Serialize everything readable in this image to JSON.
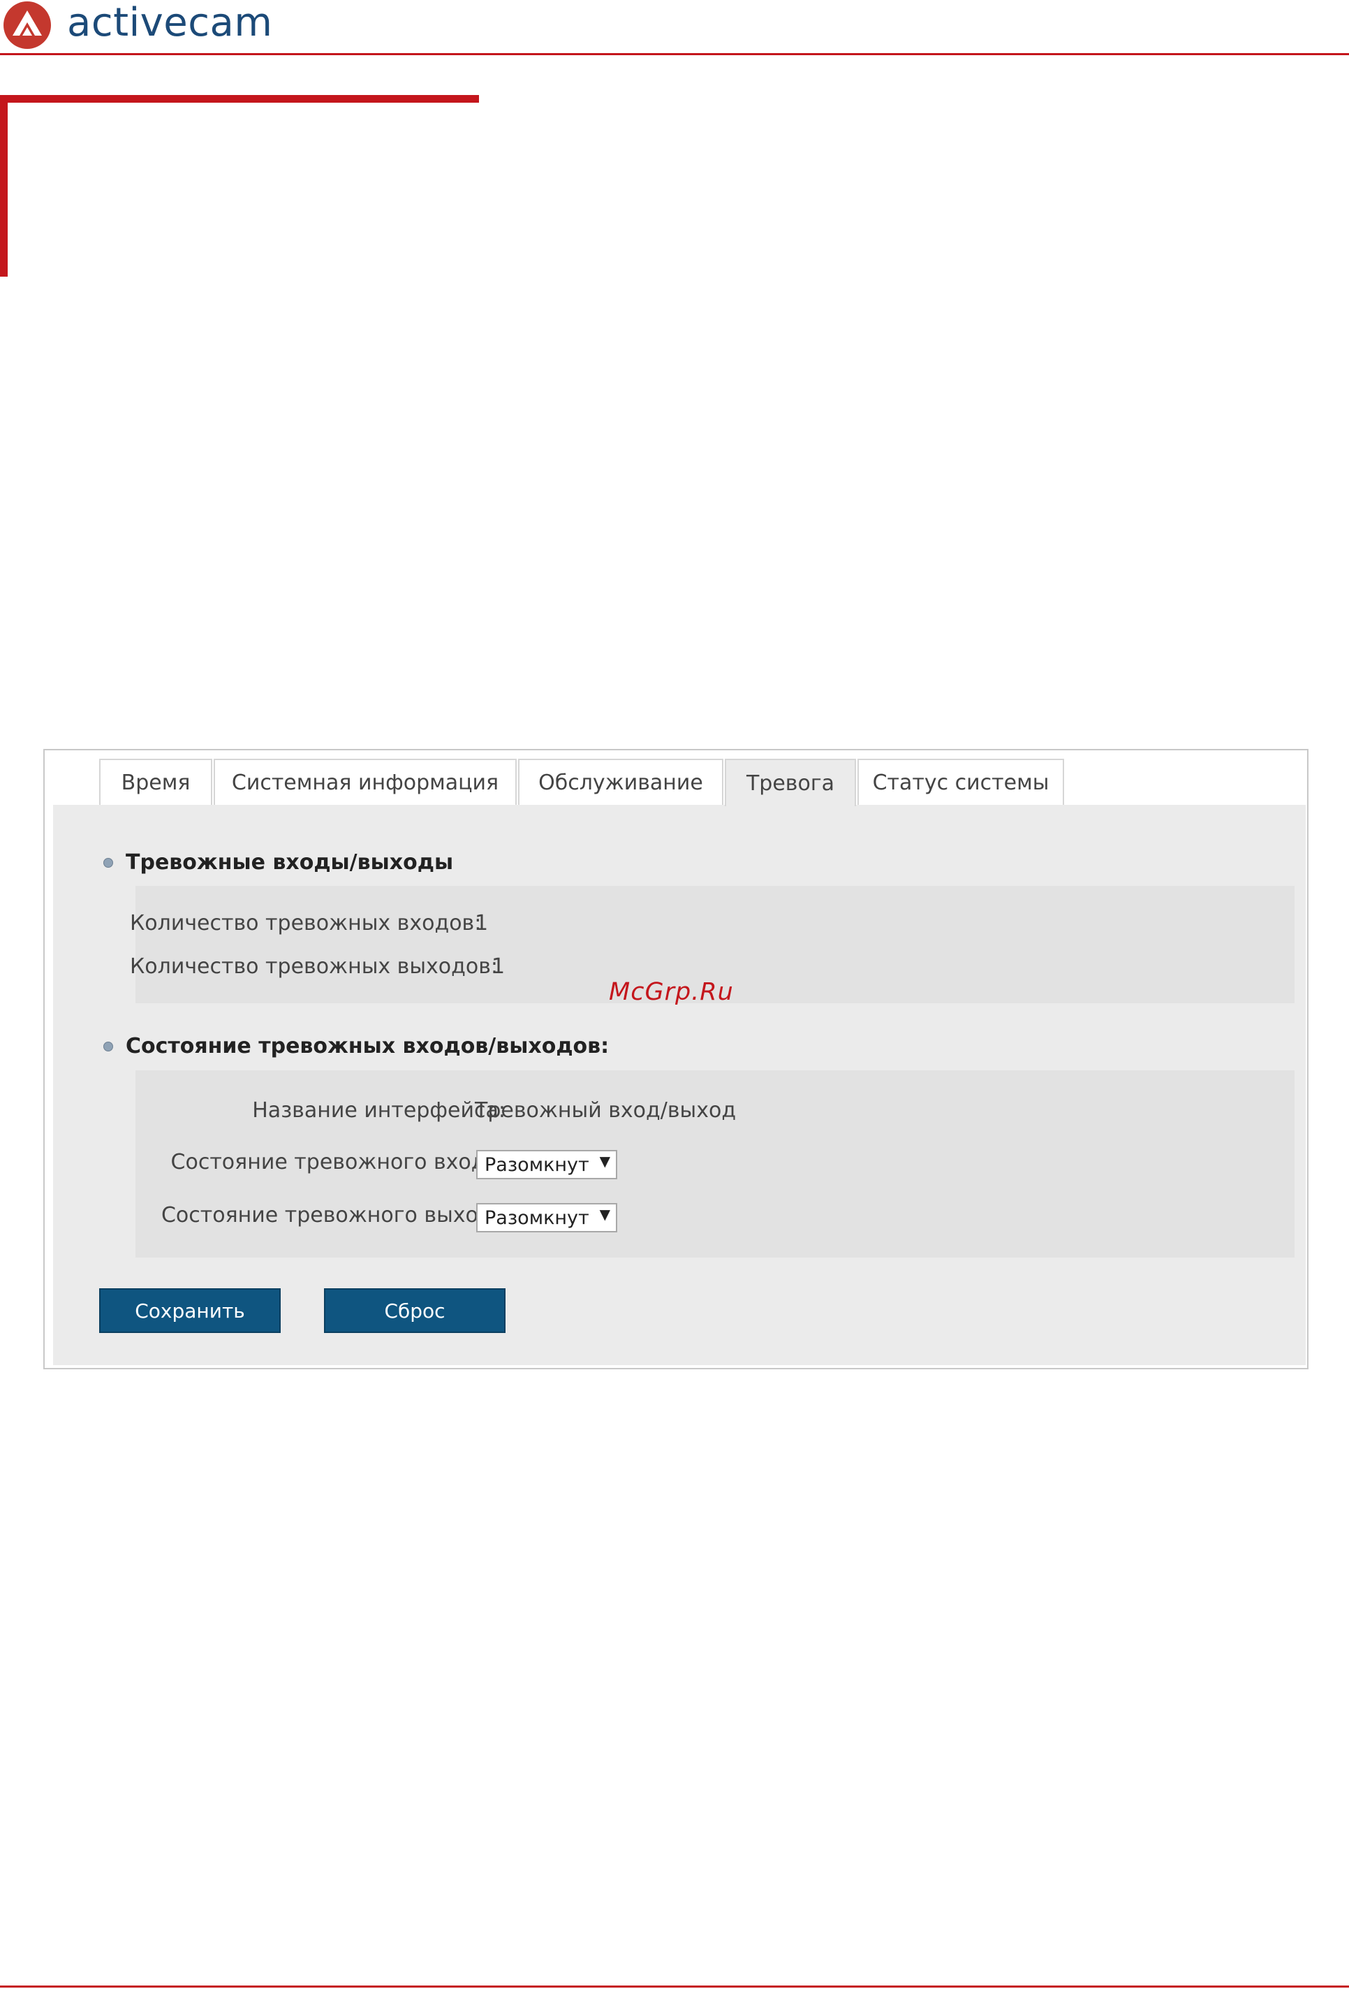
{
  "header": {
    "brand": "activecam"
  },
  "tabs": [
    {
      "label": "Время"
    },
    {
      "label": "Системная информация"
    },
    {
      "label": "Обслуживание"
    },
    {
      "label": "Тревога",
      "active": true
    },
    {
      "label": "Статус системы"
    }
  ],
  "alarm_io": {
    "title": "Тревожные входы/выходы",
    "inputs_label": "Количество тревожных входов:",
    "inputs_value": "1",
    "outputs_label": "Количество тревожных выходов:",
    "outputs_value": "1"
  },
  "alarm_state": {
    "title": "Состояние тревожных входов/выходов:",
    "interface_label": "Название интерфейса:",
    "interface_value": "Тревожный вход/выход",
    "input_state_label": "Состояние тревожного входа:",
    "input_state_value": "Разомкнут",
    "output_state_label": "Состояние тревожного выхода",
    "output_state_value": "Разомкнут"
  },
  "buttons": {
    "save": "Сохранить",
    "reset": "Сброс"
  },
  "watermark": "McGrp.Ru",
  "colors": {
    "accent_red": "#c4161c",
    "brand_blue": "#1c4a78",
    "button_blue": "#0f5580"
  }
}
